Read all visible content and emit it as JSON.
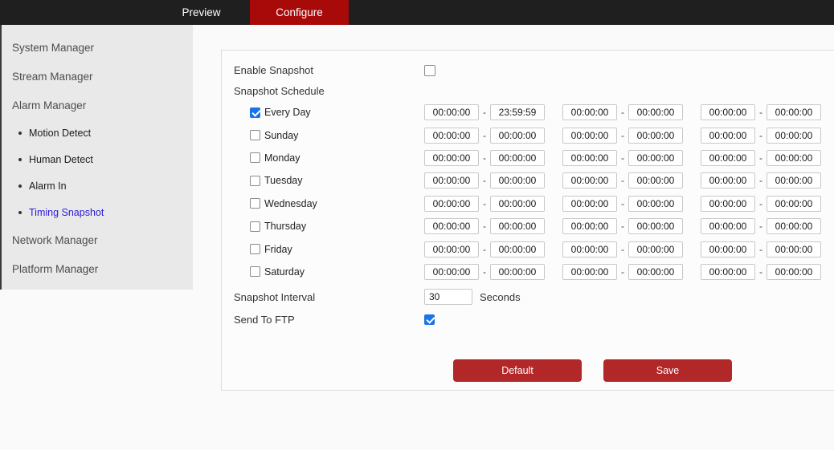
{
  "colors": {
    "topbar_bg": "#1f1f1f",
    "active_tab_bg": "#a80a0a",
    "sidebar_bg": "#e9e9e9",
    "page_bg": "#fafafa",
    "panel_bg": "#fcfcfc",
    "panel_border": "#dcdcdc",
    "button_bg": "#b22728",
    "checkbox_checked": "#1a73e8",
    "selected_item_text": "#2a1cd8"
  },
  "topbar": {
    "tabs": [
      {
        "label": "Preview",
        "active": false
      },
      {
        "label": "Configure",
        "active": true
      }
    ]
  },
  "sidebar": {
    "items": [
      {
        "label": "System Manager",
        "level": "top",
        "selected": false
      },
      {
        "label": "Stream Manager",
        "level": "top",
        "selected": false
      },
      {
        "label": "Alarm Manager",
        "level": "top",
        "selected": false
      },
      {
        "label": "Motion Detect",
        "level": "sub",
        "selected": false
      },
      {
        "label": "Human Detect",
        "level": "sub",
        "selected": false
      },
      {
        "label": "Alarm In",
        "level": "sub",
        "selected": false
      },
      {
        "label": "Timing Snapshot",
        "level": "sub",
        "selected": true
      },
      {
        "label": "Network Manager",
        "level": "top",
        "selected": false
      },
      {
        "label": "Platform Manager",
        "level": "top",
        "selected": false
      }
    ]
  },
  "form": {
    "enable_snapshot_label": "Enable Snapshot",
    "enable_snapshot_checked": false,
    "schedule_label": "Snapshot Schedule",
    "time_separator": "-",
    "schedule_rows": [
      {
        "day": "Every Day",
        "checked": true,
        "times": [
          "00:00:00",
          "23:59:59",
          "00:00:00",
          "00:00:00",
          "00:00:00",
          "00:00:00"
        ]
      },
      {
        "day": "Sunday",
        "checked": false,
        "times": [
          "00:00:00",
          "00:00:00",
          "00:00:00",
          "00:00:00",
          "00:00:00",
          "00:00:00"
        ]
      },
      {
        "day": "Monday",
        "checked": false,
        "times": [
          "00:00:00",
          "00:00:00",
          "00:00:00",
          "00:00:00",
          "00:00:00",
          "00:00:00"
        ]
      },
      {
        "day": "Tuesday",
        "checked": false,
        "times": [
          "00:00:00",
          "00:00:00",
          "00:00:00",
          "00:00:00",
          "00:00:00",
          "00:00:00"
        ]
      },
      {
        "day": "Wednesday",
        "checked": false,
        "times": [
          "00:00:00",
          "00:00:00",
          "00:00:00",
          "00:00:00",
          "00:00:00",
          "00:00:00"
        ]
      },
      {
        "day": "Thursday",
        "checked": false,
        "times": [
          "00:00:00",
          "00:00:00",
          "00:00:00",
          "00:00:00",
          "00:00:00",
          "00:00:00"
        ]
      },
      {
        "day": "Friday",
        "checked": false,
        "times": [
          "00:00:00",
          "00:00:00",
          "00:00:00",
          "00:00:00",
          "00:00:00",
          "00:00:00"
        ]
      },
      {
        "day": "Saturday",
        "checked": false,
        "times": [
          "00:00:00",
          "00:00:00",
          "00:00:00",
          "00:00:00",
          "00:00:00",
          "00:00:00"
        ]
      }
    ],
    "interval_label": "Snapshot Interval",
    "interval_value": "30",
    "interval_unit": "Seconds",
    "ftp_label": "Send To FTP",
    "ftp_checked": true,
    "buttons": [
      {
        "label": "Default"
      },
      {
        "label": "Save"
      }
    ]
  }
}
